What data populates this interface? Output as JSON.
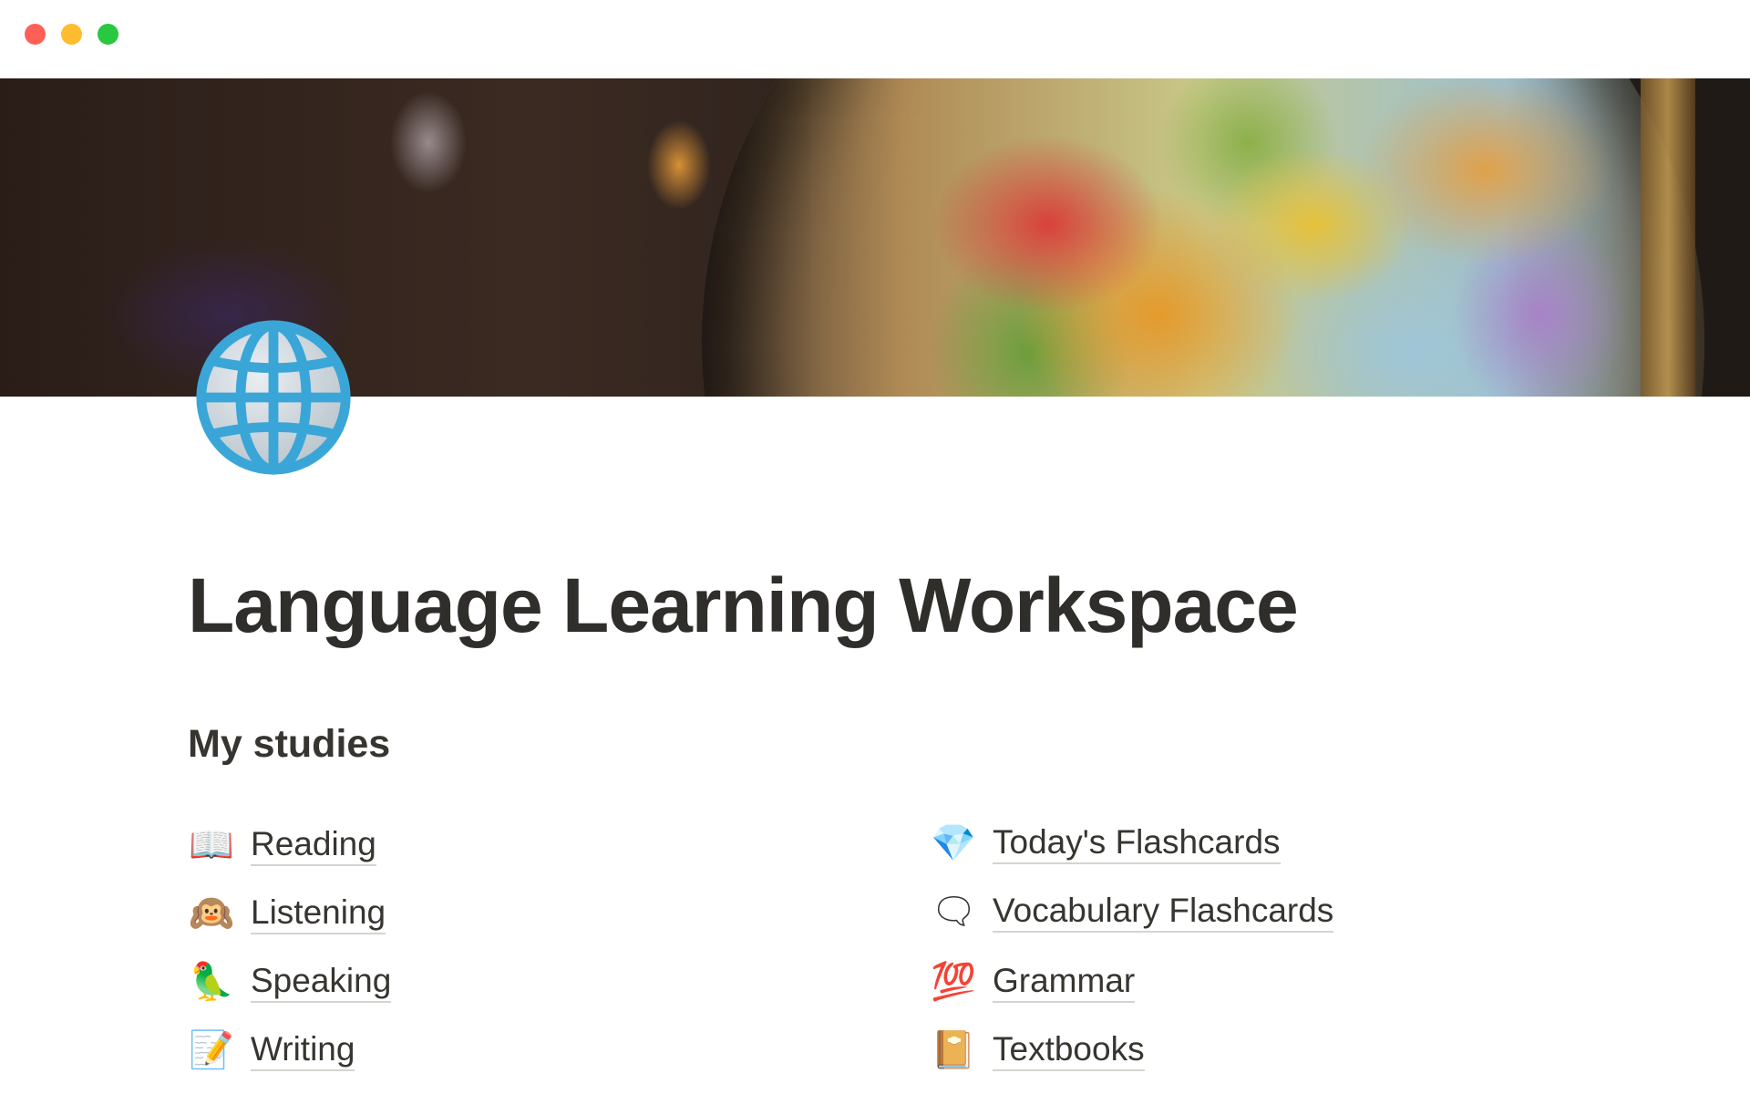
{
  "window": {
    "controls": {
      "close_color": "#fe5f57",
      "minimize_color": "#febc2e",
      "maximize_color": "#28c840"
    }
  },
  "page": {
    "cover": "globe-photo",
    "icon": "globe-with-meridians",
    "title": "Language Learning Workspace",
    "section_heading": "My studies",
    "left_links": [
      {
        "emoji": "📖",
        "icon": "open-book-icon",
        "label": "Reading"
      },
      {
        "emoji": "🙉",
        "icon": "hear-no-evil-monkey-icon",
        "label": "Listening"
      },
      {
        "emoji": "🦜",
        "icon": "parrot-icon",
        "label": "Speaking"
      },
      {
        "emoji": "📝",
        "icon": "memo-icon",
        "label": "Writing"
      }
    ],
    "right_links": [
      {
        "emoji": "💎",
        "icon": "gem-icon",
        "label": "Today's Flashcards"
      },
      {
        "emoji": "🗨",
        "icon": "speech-bubble-icon",
        "label": "Vocabulary Flashcards"
      },
      {
        "emoji": "💯",
        "icon": "hundred-points-icon",
        "label": "Grammar"
      },
      {
        "emoji": "📔",
        "icon": "notebook-icon",
        "label": "Textbooks"
      }
    ]
  }
}
